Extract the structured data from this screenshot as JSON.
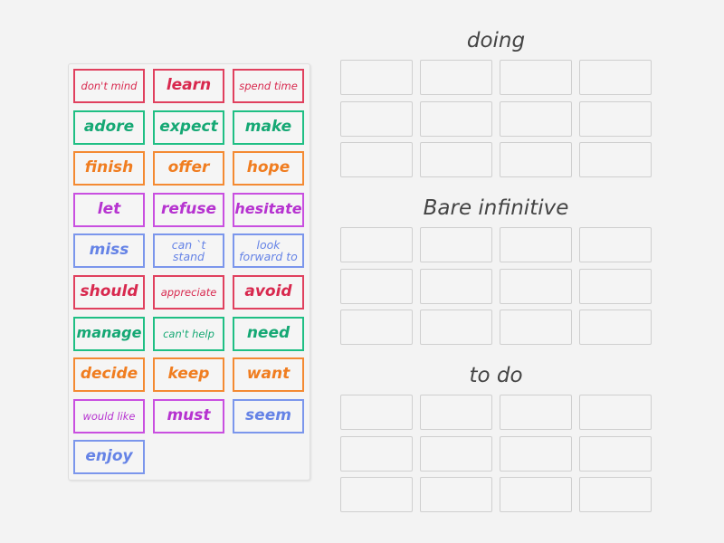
{
  "activity": {
    "type": "group-sort",
    "tray_cards": [
      {
        "label": "don't mind",
        "color": "red"
      },
      {
        "label": "learn",
        "color": "red"
      },
      {
        "label": "spend time",
        "color": "red"
      },
      {
        "label": "adore",
        "color": "green"
      },
      {
        "label": "expect",
        "color": "green"
      },
      {
        "label": "make",
        "color": "green"
      },
      {
        "label": "finish",
        "color": "orange"
      },
      {
        "label": "offer",
        "color": "orange"
      },
      {
        "label": "hope",
        "color": "orange"
      },
      {
        "label": "let",
        "color": "purple"
      },
      {
        "label": "refuse",
        "color": "purple"
      },
      {
        "label": "hesitate",
        "color": "purple"
      },
      {
        "label": "miss",
        "color": "blue"
      },
      {
        "label": "can `t stand",
        "color": "blue"
      },
      {
        "label": "look forward to",
        "color": "blue"
      },
      {
        "label": "should",
        "color": "red"
      },
      {
        "label": "appreciate",
        "color": "red"
      },
      {
        "label": "avoid",
        "color": "red"
      },
      {
        "label": "manage",
        "color": "green"
      },
      {
        "label": "can't help",
        "color": "green"
      },
      {
        "label": "need",
        "color": "green"
      },
      {
        "label": "decide",
        "color": "orange"
      },
      {
        "label": "keep",
        "color": "orange"
      },
      {
        "label": "want",
        "color": "orange"
      },
      {
        "label": "would like",
        "color": "purple"
      },
      {
        "label": "must",
        "color": "purple"
      },
      {
        "label": "seem",
        "color": "blue"
      },
      {
        "label": "enjoy",
        "color": "blue"
      }
    ],
    "groups": [
      {
        "title": "doing",
        "slots": 12
      },
      {
        "title": "Bare infinitive",
        "slots": 12
      },
      {
        "title": "to do",
        "slots": 12
      }
    ],
    "colors": {
      "red": "#e0405e",
      "green": "#1fbf84",
      "orange": "#f48a32",
      "purple": "#c94fe0",
      "blue": "#7b96ec"
    }
  }
}
